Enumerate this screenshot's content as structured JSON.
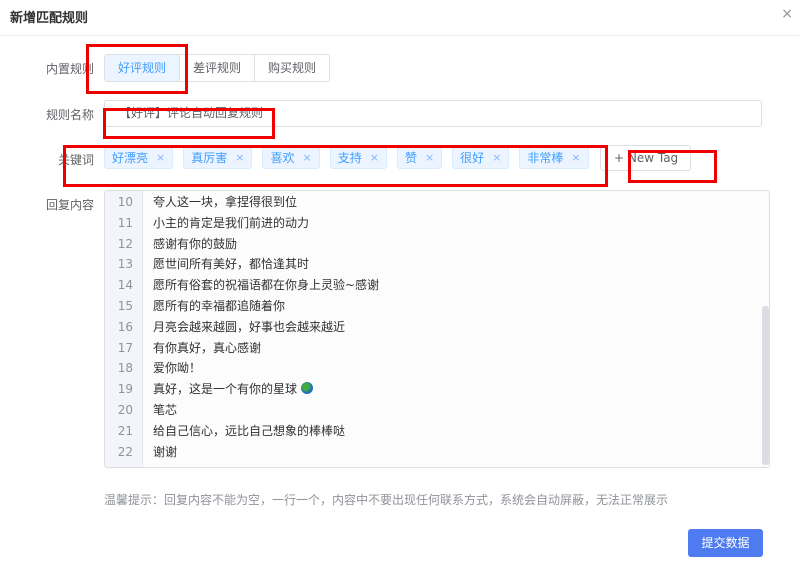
{
  "dialog": {
    "title": "新增匹配规则",
    "close": "×"
  },
  "form": {
    "builtin_label": "内置规则",
    "builtin_options": [
      "好评规则",
      "差评规则",
      "购买规则"
    ],
    "name_label": "规则名称",
    "name_value": "【好评】评论自动回复规则",
    "keywords_label": "关键词",
    "tags": [
      "好漂亮",
      "真厉害",
      "喜欢",
      "支持",
      "赞",
      "很好",
      "非常棒"
    ],
    "tag_close": "×",
    "new_tag": "+ New Tag",
    "reply_label": "回复内容",
    "lines": [
      {
        "n": "10",
        "t": "夸人这一块，拿捏得很到位"
      },
      {
        "n": "11",
        "t": "小主的肯定是我们前进的动力"
      },
      {
        "n": "12",
        "t": "感谢有你的鼓励"
      },
      {
        "n": "13",
        "t": "愿世间所有美好，都恰逢其时"
      },
      {
        "n": "14",
        "t": "愿所有俗套的祝福语都在你身上灵验~感谢"
      },
      {
        "n": "15",
        "t": "愿所有的幸福都追随着你"
      },
      {
        "n": "16",
        "t": "月亮会越来越圆，好事也会越来越近"
      },
      {
        "n": "17",
        "t": "有你真好，真心感谢"
      },
      {
        "n": "18",
        "t": "爱你呦！"
      },
      {
        "n": "19",
        "t": "真好，这是一个有你的星球"
      },
      {
        "n": "20",
        "t": "笔芯"
      },
      {
        "n": "21",
        "t": "给自己信心，远比自己想象的棒棒哒"
      },
      {
        "n": "22",
        "t": "谢谢"
      }
    ],
    "hint": "温馨提示：回复内容不能为空，一行一个，内容中不要出现任何联系方式，系统会自动屏蔽，无法正常展示",
    "submit": "提交数据"
  },
  "colors": {
    "primary": "#4e7cf0",
    "tag_bg": "#ecf5ff",
    "annotation": "#ee0000"
  }
}
